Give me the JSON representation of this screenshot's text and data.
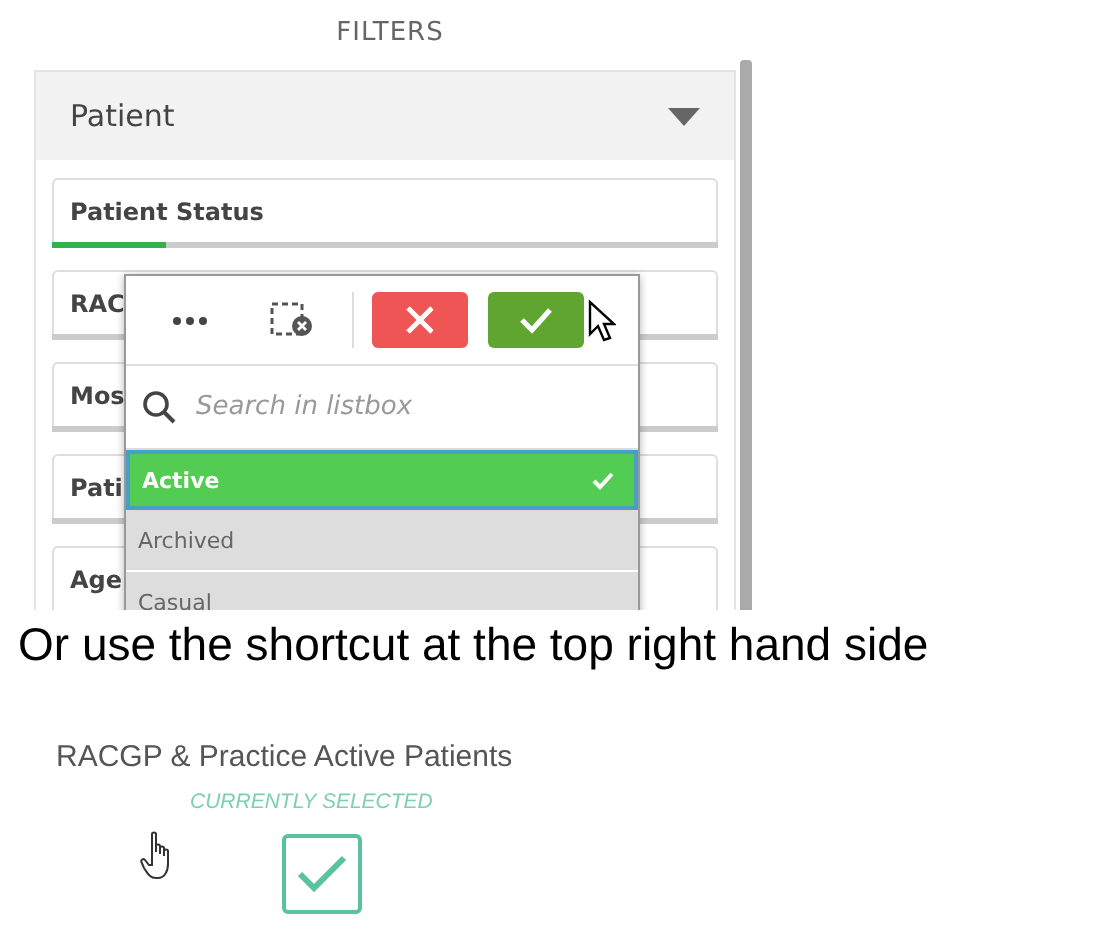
{
  "filters_panel": {
    "title": "FILTERS",
    "section": {
      "label": "Patient",
      "expanded": true
    },
    "filters": [
      {
        "label": "Patient Status",
        "level": 0.17
      },
      {
        "label": "RAC"
      },
      {
        "label": "Mos"
      },
      {
        "label": "Pati"
      },
      {
        "label": "Age"
      }
    ]
  },
  "listbox_popup": {
    "search": {
      "placeholder": "Search in listbox"
    },
    "items": [
      {
        "label": "Active",
        "selected": true
      },
      {
        "label": "Archived",
        "selected": false
      },
      {
        "label": "Casual",
        "selected": false
      }
    ]
  },
  "caption": "Or use the shortcut at the top right hand side",
  "shortcut": {
    "title": "RACGP & Practice Active Patients",
    "status": "CURRENTLY SELECTED",
    "checked": true
  }
}
